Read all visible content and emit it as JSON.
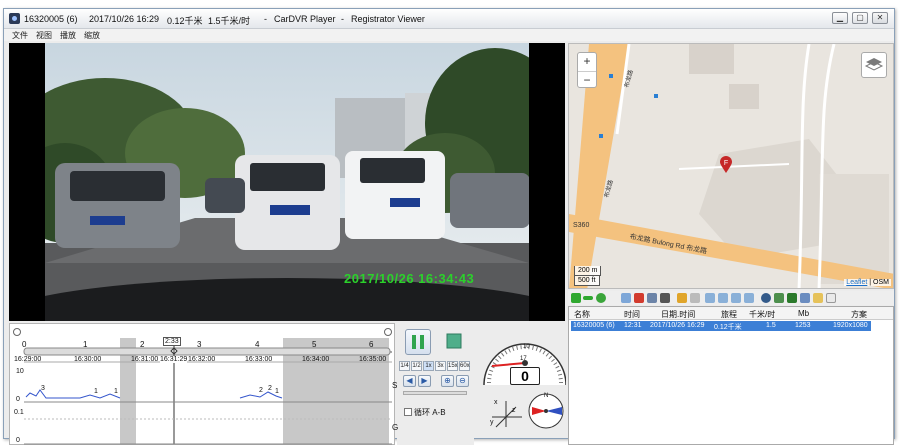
{
  "window": {
    "title_parts": [
      "16320005 (6)",
      "2017/10/26 16:29",
      "0.12千米",
      "1.5千米/时",
      "-",
      "CarDVR Player",
      "-",
      "Registrator Viewer"
    ],
    "controls": [
      "minimize-icon",
      "maximize-icon",
      "close-icon"
    ]
  },
  "menu": [
    "文件",
    "视图",
    "播放",
    "缩放"
  ],
  "video": {
    "osd_timestamp": "2017/10/26 16:34:43"
  },
  "map": {
    "zoom_in": "+",
    "zoom_out": "−",
    "scale_m": "200 m",
    "scale_ft": "500 ft",
    "labels": [
      "S360",
      "布龙路 Bulong Rd 布龙路",
      "布龙路",
      "布龙路"
    ],
    "marker_label": "F",
    "attribution_link": "Leaflet",
    "attribution_text": "| OSM"
  },
  "file_list": {
    "columns": [
      "名称",
      "时间",
      "日期.时间",
      "旅程",
      "千米/时",
      "Mb",
      "方案"
    ],
    "rows": [
      [
        "16320005 (6)",
        "12:31",
        "2017/10/26 16:29",
        "0.12千米",
        "1.5",
        "1253",
        "1920x1080"
      ]
    ]
  },
  "timeline": {
    "segments": [
      "0",
      "1",
      "2",
      "2:33",
      "3",
      "4",
      "5",
      "6"
    ],
    "times": [
      "16:29:00",
      "16:30:00",
      "16:31:00",
      "16:31:29",
      "16:32:00",
      "16:33:00",
      "16:34:00",
      "16:35:00"
    ],
    "y_labels_top": [
      "10",
      "0"
    ],
    "y_labels_bottom": [
      "0.1",
      "0"
    ],
    "track_S": "S",
    "track_G": "G",
    "marks": [
      "3",
      "1",
      "1",
      "2",
      "2",
      "1"
    ]
  },
  "controls": {
    "speeds": [
      "1/4",
      "1/2",
      "1x",
      "3x",
      "15x",
      "60x"
    ],
    "active_speed": "1x",
    "loop_label": "循环 A-B"
  },
  "gauges": {
    "speed": "0",
    "dial_ticks": [
      "10",
      "17"
    ],
    "accel_axes": [
      "x",
      "y",
      "z"
    ],
    "compass_label": "N"
  },
  "colors": {
    "title_bg": "#e9edf2",
    "selection": "#3c7fd6",
    "osd_green": "#2bd12b",
    "gray_band": "#c8c8c8",
    "map_road": "#f4c27f"
  }
}
